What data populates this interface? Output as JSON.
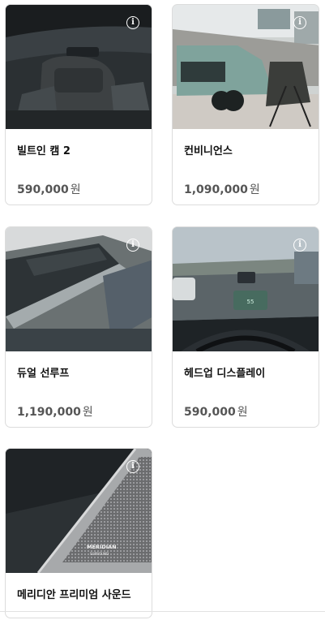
{
  "options": [
    {
      "title": "빌트인 캠 2",
      "price": "590,000",
      "unit": "원"
    },
    {
      "title": "컨비니언스",
      "price": "1,090,000",
      "unit": "원"
    },
    {
      "title": "듀얼 선루프",
      "price": "1,190,000",
      "unit": "원"
    },
    {
      "title": "헤드업 디스플레이",
      "price": "590,000",
      "unit": "원"
    },
    {
      "title": "메리디안 프리미엄 사운드",
      "price": "",
      "unit": ""
    }
  ],
  "info_glyph": "i",
  "badges": {
    "meridian": "MERIDIAN",
    "meridian_sub": "SURROUND"
  },
  "icons": {
    "info": "info-circle-icon"
  }
}
